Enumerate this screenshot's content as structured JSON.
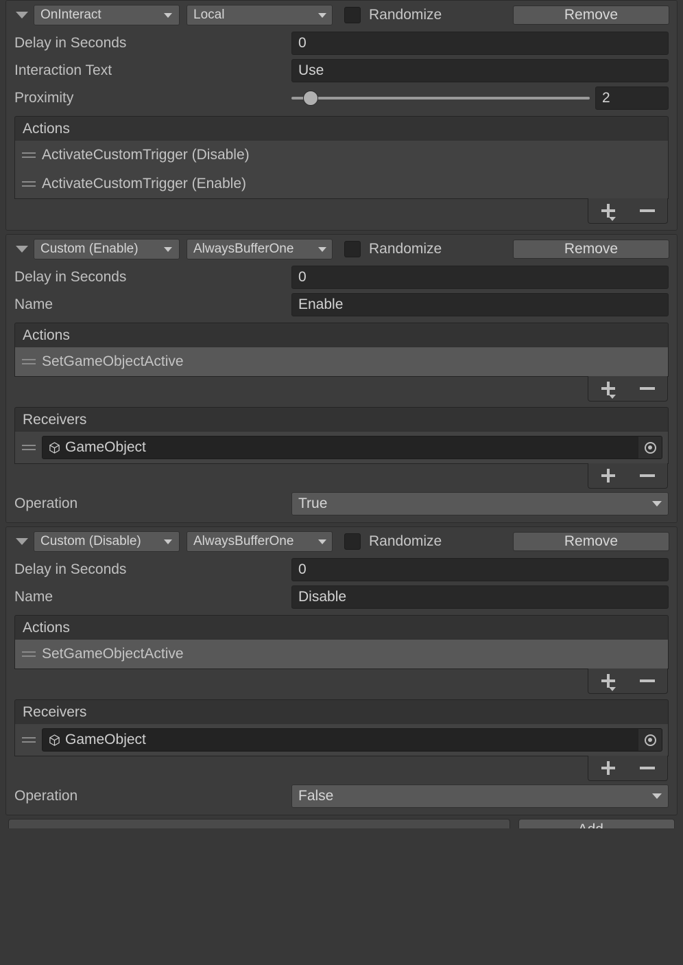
{
  "labels": {
    "randomize": "Randomize",
    "remove": "Remove",
    "delay": "Delay in Seconds",
    "interaction_text": "Interaction Text",
    "proximity": "Proximity",
    "name": "Name",
    "operation": "Operation",
    "actions": "Actions",
    "receivers": "Receivers",
    "gameobject": "GameObject",
    "add_button": "Add..."
  },
  "colors": {
    "window_bg": "#383838",
    "block_bg": "#3c3c3c",
    "dropdown_bg": "#585858",
    "input_bg": "#282828",
    "object_field_bg": "#232323",
    "list_bg": "#424242",
    "list_header_bg": "#333333",
    "selected_row_bg": "#585858",
    "text": "#c8c8c8",
    "border": "#242424"
  },
  "events": [
    {
      "trigger": "OnInteract",
      "network_mode": "Local",
      "randomize_checked": false,
      "remove_label": "Remove",
      "fields": [
        {
          "type": "text",
          "label": "Delay in Seconds",
          "value": "0"
        },
        {
          "type": "text",
          "label": "Interaction Text",
          "value": "Use"
        },
        {
          "type": "slider",
          "label": "Proximity",
          "value": "2",
          "slider_percent": 4
        }
      ],
      "actions": {
        "header": "Actions",
        "items": [
          {
            "label": "ActivateCustomTrigger (Disable)",
            "selected": false
          },
          {
            "label": "ActivateCustomTrigger (Enable)",
            "selected": false
          }
        ],
        "plus_has_dropdown": true
      },
      "receivers": null,
      "operation": null
    },
    {
      "trigger": "Custom (Enable)",
      "network_mode": "AlwaysBufferOne",
      "randomize_checked": false,
      "remove_label": "Remove",
      "fields": [
        {
          "type": "text",
          "label": "Delay in Seconds",
          "value": "0"
        },
        {
          "type": "text",
          "label": "Name",
          "value": "Enable"
        }
      ],
      "actions": {
        "header": "Actions",
        "items": [
          {
            "label": "SetGameObjectActive",
            "selected": true
          }
        ],
        "plus_has_dropdown": true
      },
      "receivers": {
        "header": "Receivers",
        "items": [
          {
            "label": "GameObject"
          }
        ],
        "plus_has_dropdown": false
      },
      "operation": {
        "label": "Operation",
        "value": "True"
      }
    },
    {
      "trigger": "Custom (Disable)",
      "network_mode": "AlwaysBufferOne",
      "randomize_checked": false,
      "remove_label": "Remove",
      "fields": [
        {
          "type": "text",
          "label": "Delay in Seconds",
          "value": "0"
        },
        {
          "type": "text",
          "label": "Name",
          "value": "Disable"
        }
      ],
      "actions": {
        "header": "Actions",
        "items": [
          {
            "label": "SetGameObjectActive",
            "selected": true
          }
        ],
        "plus_has_dropdown": true
      },
      "receivers": {
        "header": "Receivers",
        "items": [
          {
            "label": "GameObject"
          }
        ],
        "plus_has_dropdown": false
      },
      "operation": {
        "label": "Operation",
        "value": "False"
      }
    }
  ],
  "bottom_bar": {
    "add_label": "Add..."
  }
}
